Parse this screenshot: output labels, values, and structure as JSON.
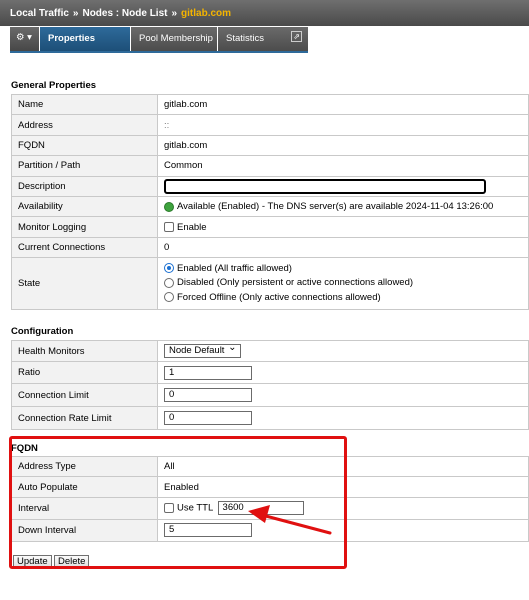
{
  "breadcrumb": {
    "part1": "Local Traffic",
    "sep1": "»",
    "part2": "Nodes : Node List",
    "sep2": "»",
    "current": "gitlab.com"
  },
  "tabs": {
    "gear": "⚙ ▾",
    "properties": "Properties",
    "pool_membership": "Pool Membership",
    "statistics": "Statistics",
    "external_icon": "⇗"
  },
  "general": {
    "heading": "General Properties",
    "name_label": "Name",
    "name_value": "gitlab.com",
    "address_label": "Address",
    "address_value": "::",
    "fqdn_label": "FQDN",
    "fqdn_value": "gitlab.com",
    "partition_label": "Partition / Path",
    "partition_value": "Common",
    "description_label": "Description",
    "description_value": "",
    "availability_label": "Availability",
    "availability_value": "Available (Enabled) - The DNS server(s) are available 2024-11-04 13:26:00",
    "monitor_logging_label": "Monitor Logging",
    "monitor_logging_option": "Enable",
    "connections_label": "Current Connections",
    "connections_value": "0",
    "state_label": "State",
    "state_options": [
      "Enabled (All traffic allowed)",
      "Disabled (Only persistent or active connections allowed)",
      "Forced Offline (Only active connections allowed)"
    ]
  },
  "configuration": {
    "heading": "Configuration",
    "health_label": "Health Monitors",
    "health_value": "Node Default",
    "ratio_label": "Ratio",
    "ratio_value": "1",
    "conn_limit_label": "Connection Limit",
    "conn_limit_value": "0",
    "conn_rate_label": "Connection Rate Limit",
    "conn_rate_value": "0"
  },
  "fqdn": {
    "heading": "FQDN",
    "address_type_label": "Address Type",
    "address_type_value": "All",
    "auto_populate_label": "Auto Populate",
    "auto_populate_value": "Enabled",
    "interval_label": "Interval",
    "use_ttl_label": "Use TTL",
    "interval_value": "3600",
    "down_interval_label": "Down Interval",
    "down_interval_value": "5"
  },
  "buttons": {
    "update": "Update",
    "delete": "Delete"
  },
  "colors": {
    "highlight": "#e01010",
    "active_tab": "#2e6a9a",
    "breadcrumb_current": "#f4b400"
  }
}
